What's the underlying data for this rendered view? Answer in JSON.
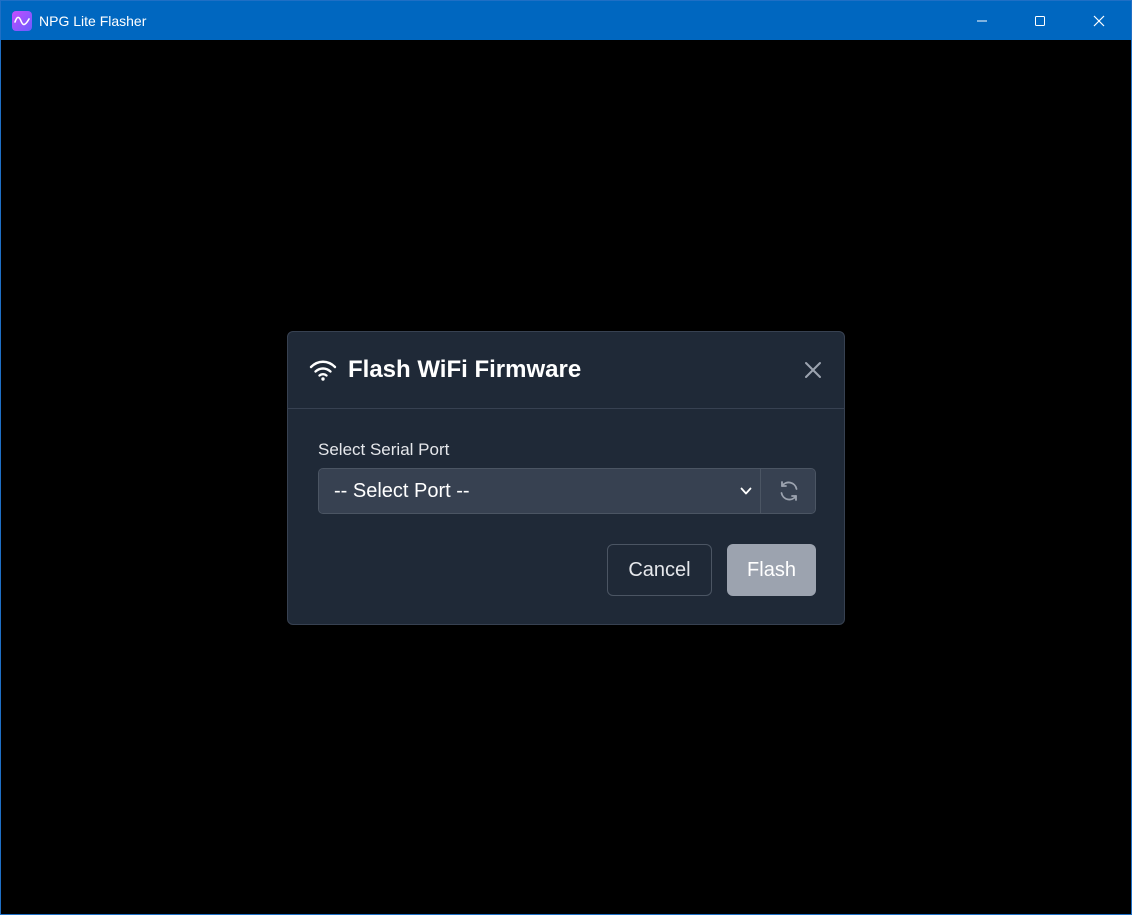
{
  "window": {
    "title": "NPG Lite Flasher",
    "controls": [
      "minimize-icon",
      "maximize-icon",
      "close-icon"
    ]
  },
  "dialog": {
    "title": "Flash WiFi Firmware",
    "icon": "wifi-icon",
    "close_icon": "close-icon",
    "port_label": "Select Serial Port",
    "port_select": {
      "selected": "-- Select Port --"
    },
    "refresh_icon": "refresh-icon",
    "cancel_label": "Cancel",
    "flash_label": "Flash"
  },
  "colors": {
    "titlebar": "#0067c0",
    "dialog_bg": "#1f2937",
    "input_bg": "#374151",
    "flash_disabled": "#9ca3af"
  }
}
